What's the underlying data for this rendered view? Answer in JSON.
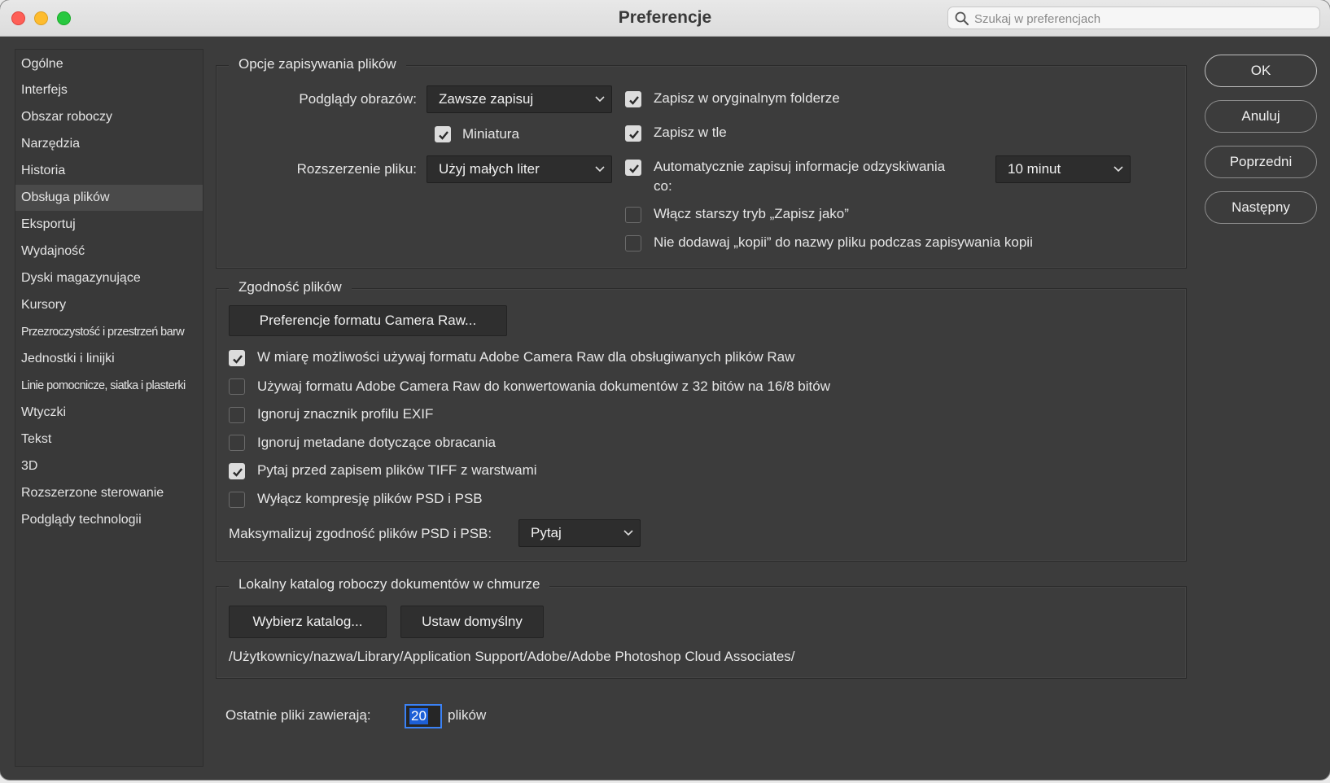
{
  "window": {
    "title": "Preferencje"
  },
  "search": {
    "placeholder": "Szukaj w preferencjach"
  },
  "sidebar": {
    "items": [
      {
        "label": "Ogólne"
      },
      {
        "label": "Interfejs"
      },
      {
        "label": "Obszar roboczy"
      },
      {
        "label": "Narzędzia"
      },
      {
        "label": "Historia"
      },
      {
        "label": "Obsługa plików",
        "active": true
      },
      {
        "label": "Eksportuj"
      },
      {
        "label": "Wydajność"
      },
      {
        "label": "Dyski magazynujące"
      },
      {
        "label": "Kursory"
      },
      {
        "label": "Przezroczystość i przestrzeń barw"
      },
      {
        "label": "Jednostki i linijki"
      },
      {
        "label": "Linie pomocnicze, siatka i plasterki"
      },
      {
        "label": "Wtyczki"
      },
      {
        "label": "Tekst"
      },
      {
        "label": "3D"
      },
      {
        "label": "Rozszerzone sterowanie"
      },
      {
        "label": "Podglądy technologii"
      }
    ]
  },
  "file_saving": {
    "legend": "Opcje zapisywania plików",
    "image_previews": {
      "label": "Podglądy obrazów:",
      "value": "Zawsze zapisuj"
    },
    "thumbnail": {
      "label": "Miniatura",
      "checked": true
    },
    "file_extension": {
      "label": "Rozszerzenie pliku:",
      "value": "Użyj małych liter"
    },
    "save_in_original_folder": {
      "label": "Zapisz w oryginalnym folderze",
      "checked": true
    },
    "save_in_background": {
      "label": "Zapisz w tle",
      "checked": true
    },
    "auto_save_recovery": {
      "label_line1": "Automatycznie zapisuj informacje odzyskiwania",
      "label_line2": "co:",
      "checked": true,
      "interval": "10 minut"
    },
    "legacy_save_as": {
      "label": "Włącz starszy tryb „Zapisz jako”",
      "checked": false
    },
    "no_copy_suffix": {
      "label": "Nie dodawaj „kopii” do nazwy pliku podczas zapisywania kopii",
      "checked": false
    }
  },
  "compatibility": {
    "legend": "Zgodność plików",
    "camera_raw_button": "Preferencje formatu Camera Raw...",
    "options": [
      {
        "label": "W miarę możliwości używaj formatu Adobe Camera Raw dla obsługiwanych plików Raw",
        "checked": true
      },
      {
        "label": "Używaj formatu Adobe Camera Raw do konwertowania dokumentów z 32 bitów na 16/8 bitów",
        "checked": false
      },
      {
        "label": "Ignoruj znacznik profilu EXIF",
        "checked": false
      },
      {
        "label": "Ignoruj metadane dotyczące obracania",
        "checked": false
      },
      {
        "label": "Pytaj przed zapisem plików TIFF z warstwami",
        "checked": true
      },
      {
        "label": "Wyłącz kompresję plików PSD i PSB",
        "checked": false
      }
    ],
    "maximize": {
      "label": "Maksymalizuj zgodność plików PSD i PSB:",
      "value": "Pytaj"
    }
  },
  "cloud": {
    "legend": "Lokalny katalog roboczy dokumentów w chmurze",
    "choose_button": "Wybierz katalog...",
    "default_button": "Ustaw domyślny",
    "path": "/Użytkownicy/nazwa/Library/Application Support/Adobe/Adobe Photoshop Cloud Associates/"
  },
  "recent": {
    "label": "Ostatnie pliki zawierają:",
    "value": "20",
    "unit": "plików"
  },
  "actions": {
    "ok": "OK",
    "cancel": "Anuluj",
    "previous": "Poprzedni",
    "next": "Następny"
  }
}
